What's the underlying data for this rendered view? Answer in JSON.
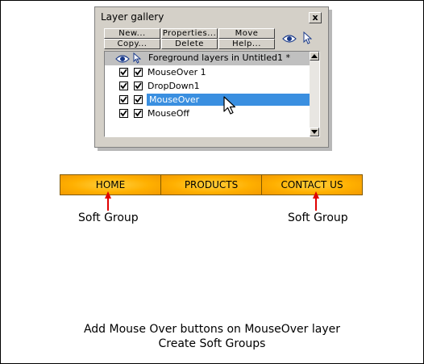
{
  "dialog": {
    "title": "Layer gallery",
    "close_label": "x",
    "buttons": {
      "new": "New...",
      "properties": "Properties...",
      "move": "Move",
      "copy": "Copy...",
      "delete": "Delete",
      "help": "Help..."
    },
    "group": {
      "label": "Foreground layers in Untitled1 *"
    },
    "layers": [
      {
        "label": "MouseOver 1",
        "visible": true,
        "locked": true,
        "selected": false
      },
      {
        "label": "DropDown1",
        "visible": true,
        "locked": true,
        "selected": false
      },
      {
        "label": "MouseOver",
        "visible": true,
        "locked": true,
        "selected": true
      },
      {
        "label": "MouseOff",
        "visible": true,
        "locked": true,
        "selected": false
      }
    ]
  },
  "nav": {
    "items": [
      "HOME",
      "PRODUCTS",
      "CONTACT US"
    ]
  },
  "annotations": {
    "soft_group_left": "Soft Group",
    "soft_group_right": "Soft Group"
  },
  "caption": {
    "line1": "Add Mouse Over buttons on MouseOver layer",
    "line2": "Create Soft Groups"
  },
  "colors": {
    "dialog_bg": "#d4d0c8",
    "selection": "#3a8fe0",
    "nav_orange": "#ffb000",
    "arrow_red": "#e00000"
  },
  "icons": [
    "eye-icon",
    "pointer-icon",
    "close-icon",
    "checkmark-icon",
    "scroll-up-icon",
    "scroll-down-icon",
    "mouse-cursor-icon",
    "red-arrow-icon"
  ]
}
